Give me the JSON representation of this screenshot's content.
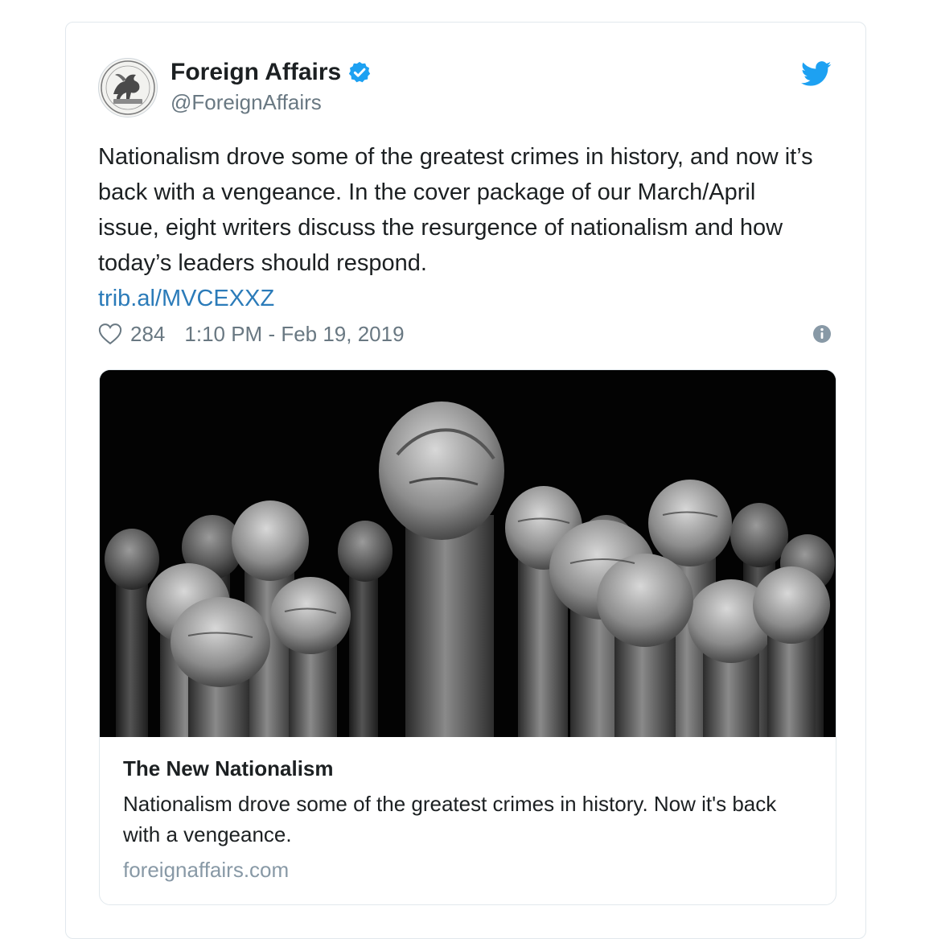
{
  "author": {
    "display_name": "Foreign Affairs",
    "screen_name": "@ForeignAffairs",
    "verified": true
  },
  "tweet": {
    "text": "Nationalism drove some of the greatest crimes in history, and now it’s back with a vengeance. In the cover package of our March/April issue, eight writers discuss the resurgence of nationalism and how today’s leaders should respond.",
    "link": "trib.al/MVCEXXZ",
    "likes": "284",
    "timestamp": "1:10 PM - Feb 19, 2019"
  },
  "card": {
    "title": "The New Nationalism",
    "description": "Nationalism drove some of the greatest crimes in history. Now it's back with a vengeance.",
    "domain": "foreignaffairs.com"
  },
  "icons": {
    "verified": "verified-badge-icon",
    "brand": "twitter-bird-icon",
    "like": "heart-icon",
    "info": "info-icon"
  },
  "colors": {
    "link": "#2b7bb9",
    "verified": "#1da1f2",
    "twitter_blue": "#1da1f2",
    "muted_text": "#697882",
    "border": "#e1e8ed"
  }
}
